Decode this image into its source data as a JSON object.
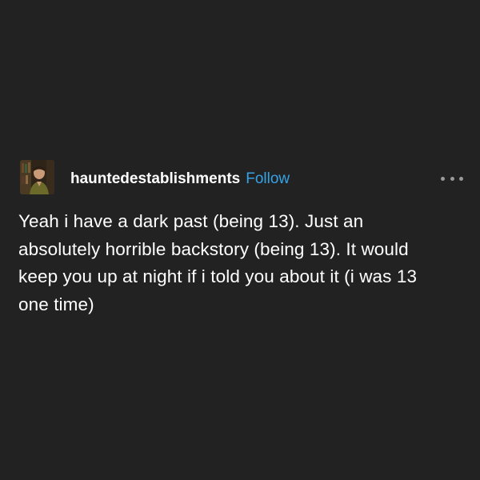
{
  "post": {
    "username": "hauntedestablishments",
    "follow_label": "Follow",
    "more_icon": "more-horizontal-icon",
    "body_lines": [
      "Yeah i have a dark past (being 13). Just an",
      "absolutely horrible backstory (being 13). It would",
      "keep you up at night if i told you about it (i was 13",
      "one time)"
    ]
  },
  "colors": {
    "background": "#222222",
    "text": "#ffffff",
    "accent_follow": "#35a3e6",
    "muted_icon": "#9a9a9a"
  }
}
